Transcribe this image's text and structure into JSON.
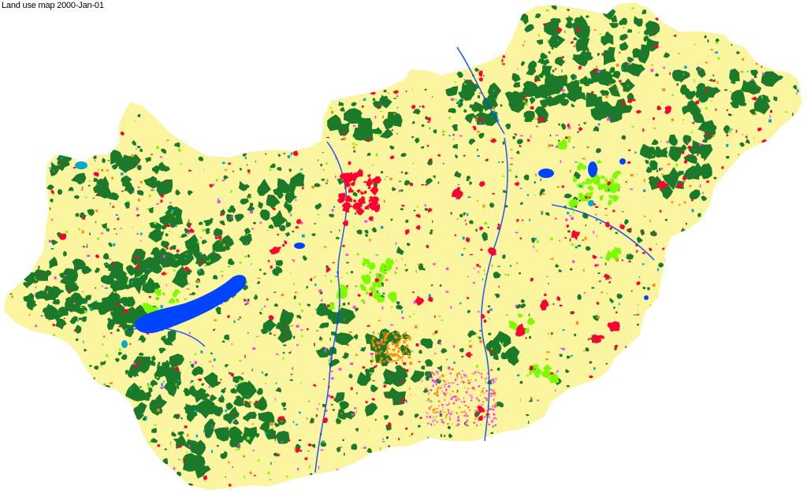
{
  "title": "Land use map 2000-Jan-01",
  "palette": {
    "background": "#ffffff",
    "agriculture": "#fcf5a0",
    "forest": "#1a7a2a",
    "urban": "#ff0033",
    "water": "#0044ff",
    "wetland": "#00aacc",
    "grassland": "#7cfc00",
    "vineyard_orchard": "#ff33ff",
    "mixed": "#ff8800"
  }
}
